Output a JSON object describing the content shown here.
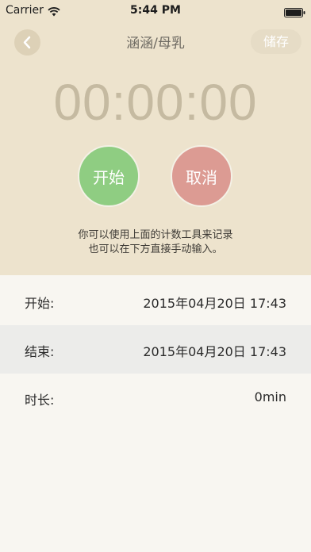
{
  "status_bar": {
    "carrier": "Carrier",
    "time": "5:44 PM"
  },
  "nav": {
    "title": "涵涵/母乳",
    "save_label": "储存",
    "back_icon": "chevron-left-icon"
  },
  "timer": {
    "display": "00:00:00"
  },
  "controls": {
    "start_label": "开始",
    "cancel_label": "取消"
  },
  "hint": {
    "line1": "你可以使用上面的计数工具来记录",
    "line2": "也可以在下方直接手动输入。"
  },
  "fields": {
    "start": {
      "label": "开始:",
      "value": "2015年04月20日 17:43"
    },
    "end": {
      "label": "结束:",
      "value": "2015年04月20日 17:43"
    },
    "duration": {
      "label": "时长:",
      "value": "0min"
    }
  },
  "colors": {
    "header_bg": "#ede3cd",
    "start_button": "#8fcd82",
    "cancel_button": "#dc9b93",
    "timer_text": "#c5baa1"
  }
}
